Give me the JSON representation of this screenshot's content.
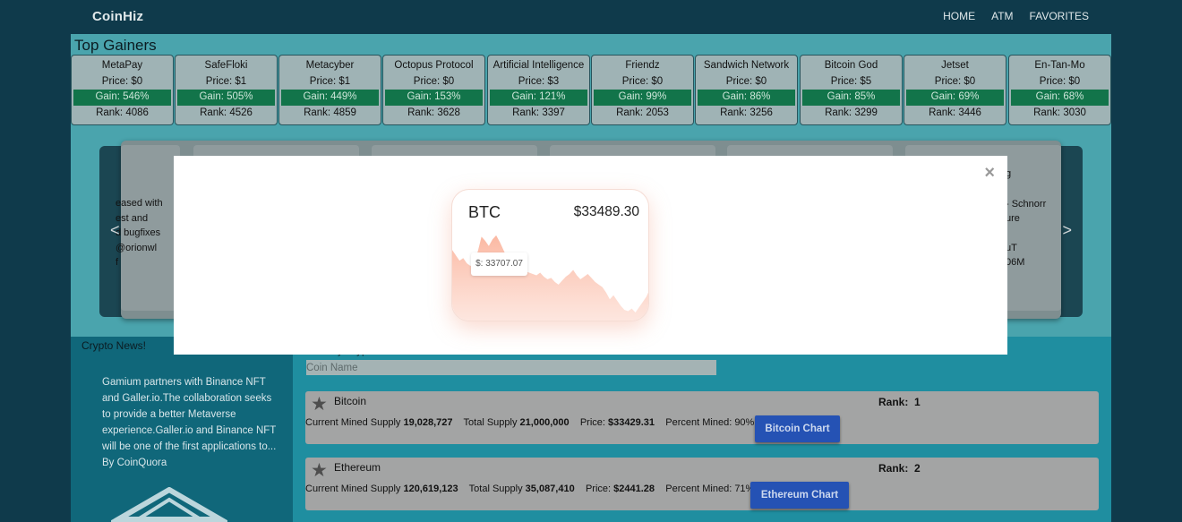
{
  "nav": {
    "brand": "CoinHiz",
    "links": [
      "HOME",
      "ATM",
      "FAVORITES"
    ]
  },
  "top_gainers": {
    "title": "Top Gainers",
    "items": [
      {
        "name": "MetaPay",
        "price": "Price: $0",
        "gain": "Gain: 546%",
        "rank": "Rank: 4086"
      },
      {
        "name": "SafeFloki",
        "price": "Price: $1",
        "gain": "Gain: 505%",
        "rank": "Rank: 4526"
      },
      {
        "name": "Metacyber",
        "price": "Price: $1",
        "gain": "Gain: 449%",
        "rank": "Rank: 4859"
      },
      {
        "name": "Octopus Protocol",
        "price": "Price: $0",
        "gain": "Gain: 153%",
        "rank": "Rank: 3628"
      },
      {
        "name": "Artificial Intelligence",
        "price": "Price: $3",
        "gain": "Gain: 121%",
        "rank": "Rank: 3397"
      },
      {
        "name": "Friendz",
        "price": "Price: $0",
        "gain": "Gain: 99%",
        "rank": "Rank: 2053"
      },
      {
        "name": "Sandwich Network",
        "price": "Price: $0",
        "gain": "Gain: 86%",
        "rank": "Rank: 3256"
      },
      {
        "name": "Bitcoin God",
        "price": "Price: $5",
        "gain": "Gain: 85%",
        "rank": "Rank: 3299"
      },
      {
        "name": "Jetset",
        "price": "Price: $0",
        "gain": "Gain: 69%",
        "rank": "Rank: 3446"
      },
      {
        "name": "En-Tan-Mo",
        "price": "Price: $0",
        "gain": "Gain: 68%",
        "rank": "Rank: 3030"
      }
    ]
  },
  "carousel": {
    "prev": "<",
    "next": ">",
    "left_lines": [
      "eased with",
      "est and",
      "d bugfixes",
      "@orionwl",
      "f"
    ],
    "right_lines": [
      "g",
      "- Schnorr",
      "ure",
      "uT",
      "06M"
    ]
  },
  "news": {
    "title": "Crypto News!",
    "body": "Gamium partners with Binance NFT and Galler.io.The collaboration seeks to provide a better Metaverse experience.Galler.io and Binance NFT will be one of the first applications to...",
    "byline": "By CoinQuora"
  },
  "coin_list": {
    "filter_label": "Filter by Crypto Name",
    "search_placeholder": "Coin Name",
    "coins": [
      {
        "name": "Bitcoin",
        "rank_label": "Rank:",
        "rank": "1",
        "mined_label": "Current Mined Supply",
        "mined": "19,028,727",
        "total_label": "Total Supply",
        "total": "21,000,000",
        "price_label": "Price:",
        "price": "$33429.31",
        "pct_label": "Percent Mined:",
        "pct": "90%",
        "button": "Bitcoin Chart"
      },
      {
        "name": "Ethereum",
        "rank_label": "Rank:",
        "rank": "2",
        "mined_label": "Current Mined Supply",
        "mined": "120,619,123",
        "total_label": "Total Supply",
        "total": "35,087,410",
        "price_label": "Price:",
        "price": "$2441.28",
        "pct_label": "Percent Mined:",
        "pct": "71%",
        "button": "Ethereum Chart"
      }
    ]
  },
  "modal": {
    "close": "×",
    "symbol": "BTC",
    "price": "$33489.30",
    "tooltip": "$: 33707.07"
  },
  "colors": {
    "navbar": "#0f3a4b",
    "container": "#4aa4ad",
    "gain_bg": "#12744a",
    "button": "#2552b4",
    "chart_fill": "#fbb8a2"
  },
  "chart_data": {
    "type": "area",
    "title": "",
    "xlabel": "",
    "ylabel": "",
    "series": [
      {
        "values": [
          33620,
          33580,
          33540,
          33560,
          33520,
          33500,
          33540,
          33610,
          33720,
          33690,
          33650,
          33700,
          33730,
          33680,
          33620,
          33560,
          33520,
          33500,
          33480,
          33470,
          33460,
          33450,
          33440,
          33430,
          33450,
          33420,
          33400,
          33410,
          33380,
          33360,
          33390,
          33420,
          33440,
          33470,
          33430,
          33400,
          33420,
          33440,
          33410,
          33380,
          33360,
          33340,
          33300,
          33250,
          33280,
          33240,
          33200,
          33170,
          33160,
          33180,
          33150,
          33190,
          33230,
          33270,
          33330
        ]
      }
    ]
  }
}
